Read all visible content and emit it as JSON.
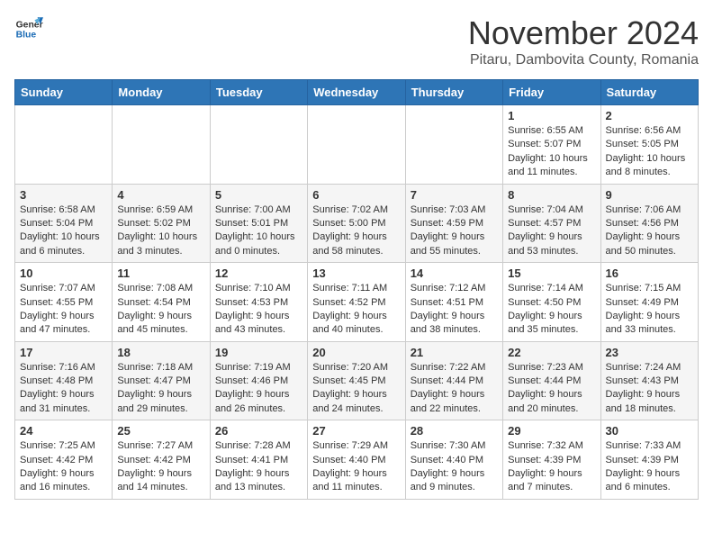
{
  "header": {
    "logo_general": "General",
    "logo_blue": "Blue",
    "month_title": "November 2024",
    "location": "Pitaru, Dambovita County, Romania"
  },
  "days_of_week": [
    "Sunday",
    "Monday",
    "Tuesday",
    "Wednesday",
    "Thursday",
    "Friday",
    "Saturday"
  ],
  "weeks": [
    [
      {
        "day": "",
        "info": ""
      },
      {
        "day": "",
        "info": ""
      },
      {
        "day": "",
        "info": ""
      },
      {
        "day": "",
        "info": ""
      },
      {
        "day": "",
        "info": ""
      },
      {
        "day": "1",
        "info": "Sunrise: 6:55 AM\nSunset: 5:07 PM\nDaylight: 10 hours and 11 minutes."
      },
      {
        "day": "2",
        "info": "Sunrise: 6:56 AM\nSunset: 5:05 PM\nDaylight: 10 hours and 8 minutes."
      }
    ],
    [
      {
        "day": "3",
        "info": "Sunrise: 6:58 AM\nSunset: 5:04 PM\nDaylight: 10 hours and 6 minutes."
      },
      {
        "day": "4",
        "info": "Sunrise: 6:59 AM\nSunset: 5:02 PM\nDaylight: 10 hours and 3 minutes."
      },
      {
        "day": "5",
        "info": "Sunrise: 7:00 AM\nSunset: 5:01 PM\nDaylight: 10 hours and 0 minutes."
      },
      {
        "day": "6",
        "info": "Sunrise: 7:02 AM\nSunset: 5:00 PM\nDaylight: 9 hours and 58 minutes."
      },
      {
        "day": "7",
        "info": "Sunrise: 7:03 AM\nSunset: 4:59 PM\nDaylight: 9 hours and 55 minutes."
      },
      {
        "day": "8",
        "info": "Sunrise: 7:04 AM\nSunset: 4:57 PM\nDaylight: 9 hours and 53 minutes."
      },
      {
        "day": "9",
        "info": "Sunrise: 7:06 AM\nSunset: 4:56 PM\nDaylight: 9 hours and 50 minutes."
      }
    ],
    [
      {
        "day": "10",
        "info": "Sunrise: 7:07 AM\nSunset: 4:55 PM\nDaylight: 9 hours and 47 minutes."
      },
      {
        "day": "11",
        "info": "Sunrise: 7:08 AM\nSunset: 4:54 PM\nDaylight: 9 hours and 45 minutes."
      },
      {
        "day": "12",
        "info": "Sunrise: 7:10 AM\nSunset: 4:53 PM\nDaylight: 9 hours and 43 minutes."
      },
      {
        "day": "13",
        "info": "Sunrise: 7:11 AM\nSunset: 4:52 PM\nDaylight: 9 hours and 40 minutes."
      },
      {
        "day": "14",
        "info": "Sunrise: 7:12 AM\nSunset: 4:51 PM\nDaylight: 9 hours and 38 minutes."
      },
      {
        "day": "15",
        "info": "Sunrise: 7:14 AM\nSunset: 4:50 PM\nDaylight: 9 hours and 35 minutes."
      },
      {
        "day": "16",
        "info": "Sunrise: 7:15 AM\nSunset: 4:49 PM\nDaylight: 9 hours and 33 minutes."
      }
    ],
    [
      {
        "day": "17",
        "info": "Sunrise: 7:16 AM\nSunset: 4:48 PM\nDaylight: 9 hours and 31 minutes."
      },
      {
        "day": "18",
        "info": "Sunrise: 7:18 AM\nSunset: 4:47 PM\nDaylight: 9 hours and 29 minutes."
      },
      {
        "day": "19",
        "info": "Sunrise: 7:19 AM\nSunset: 4:46 PM\nDaylight: 9 hours and 26 minutes."
      },
      {
        "day": "20",
        "info": "Sunrise: 7:20 AM\nSunset: 4:45 PM\nDaylight: 9 hours and 24 minutes."
      },
      {
        "day": "21",
        "info": "Sunrise: 7:22 AM\nSunset: 4:44 PM\nDaylight: 9 hours and 22 minutes."
      },
      {
        "day": "22",
        "info": "Sunrise: 7:23 AM\nSunset: 4:44 PM\nDaylight: 9 hours and 20 minutes."
      },
      {
        "day": "23",
        "info": "Sunrise: 7:24 AM\nSunset: 4:43 PM\nDaylight: 9 hours and 18 minutes."
      }
    ],
    [
      {
        "day": "24",
        "info": "Sunrise: 7:25 AM\nSunset: 4:42 PM\nDaylight: 9 hours and 16 minutes."
      },
      {
        "day": "25",
        "info": "Sunrise: 7:27 AM\nSunset: 4:42 PM\nDaylight: 9 hours and 14 minutes."
      },
      {
        "day": "26",
        "info": "Sunrise: 7:28 AM\nSunset: 4:41 PM\nDaylight: 9 hours and 13 minutes."
      },
      {
        "day": "27",
        "info": "Sunrise: 7:29 AM\nSunset: 4:40 PM\nDaylight: 9 hours and 11 minutes."
      },
      {
        "day": "28",
        "info": "Sunrise: 7:30 AM\nSunset: 4:40 PM\nDaylight: 9 hours and 9 minutes."
      },
      {
        "day": "29",
        "info": "Sunrise: 7:32 AM\nSunset: 4:39 PM\nDaylight: 9 hours and 7 minutes."
      },
      {
        "day": "30",
        "info": "Sunrise: 7:33 AM\nSunset: 4:39 PM\nDaylight: 9 hours and 6 minutes."
      }
    ]
  ]
}
